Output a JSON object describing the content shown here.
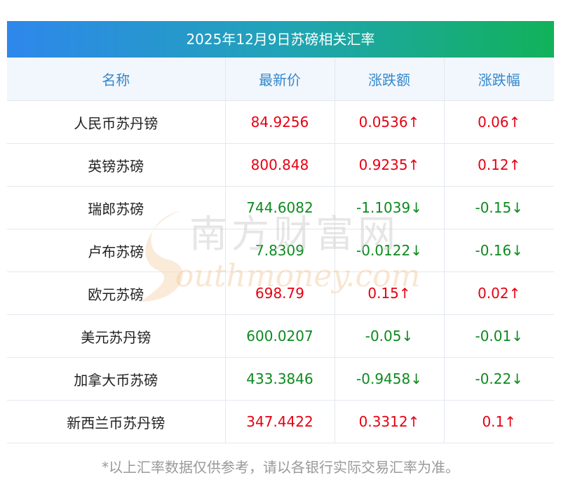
{
  "title": "2025年12月9日苏磅相关汇率",
  "headers": [
    "名称",
    "最新价",
    "涨跌额",
    "涨跌幅"
  ],
  "rows": [
    {
      "name": "人民币苏丹镑",
      "price": "84.9256",
      "change": "0.0536↑",
      "pct": "0.06↑",
      "dir": "up"
    },
    {
      "name": "英镑苏磅",
      "price": "800.848",
      "change": "0.9235↑",
      "pct": "0.12↑",
      "dir": "up"
    },
    {
      "name": "瑞郎苏磅",
      "price": "744.6082",
      "change": "-1.1039↓",
      "pct": "-0.15↓",
      "dir": "down"
    },
    {
      "name": "卢布苏磅",
      "price": "7.8309",
      "change": "-0.0122↓",
      "pct": "-0.16↓",
      "dir": "down"
    },
    {
      "name": "欧元苏磅",
      "price": "698.79",
      "change": "0.15↑",
      "pct": "0.02↑",
      "dir": "up"
    },
    {
      "name": "美元苏丹镑",
      "price": "600.0207",
      "change": "-0.05↓",
      "pct": "-0.01↓",
      "dir": "down"
    },
    {
      "name": "加拿大币苏磅",
      "price": "433.3846",
      "change": "-0.9458↓",
      "pct": "-0.22↓",
      "dir": "down"
    },
    {
      "name": "新西兰币苏丹镑",
      "price": "347.4422",
      "change": "0.3312↑",
      "pct": "0.1↑",
      "dir": "up"
    }
  ],
  "footnote": "*以上汇率数据仅供参考，请以各银行实际交易汇率为准。",
  "watermark": {
    "cn": "南方财富网",
    "en": "outhmoney.com"
  },
  "colors": {
    "up": "#e60012",
    "down": "#0d8a1f",
    "header_text": "#3388cc",
    "title_grad_start": "#2e87ec",
    "title_grad_end": "#11b25a"
  }
}
